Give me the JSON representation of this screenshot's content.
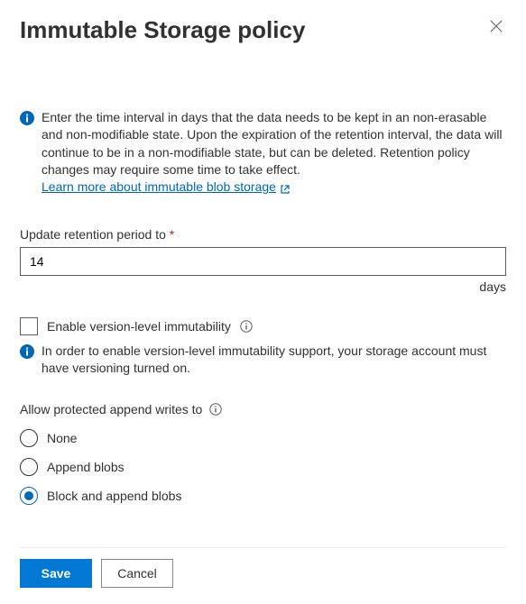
{
  "header": {
    "title": "Immutable Storage policy"
  },
  "info": {
    "text": "Enter the time interval in days that the data needs to be kept in an non-erasable and non-modifiable state. Upon the expiration of the retention interval, the data will continue to be in a non-modifiable state, but can be deleted. Retention policy changes may require some time to take effect.",
    "link_text": "Learn more about immutable blob storage"
  },
  "retention": {
    "label": "Update retention period to",
    "value": "14",
    "unit": "days"
  },
  "version_immutability": {
    "checkbox_label": "Enable version-level immutability",
    "info_text": "In order to enable version-level immutability support, your storage account must have versioning turned on."
  },
  "append_writes": {
    "label": "Allow protected append writes to",
    "options": {
      "none": "None",
      "append": "Append blobs",
      "block_append": "Block and append blobs"
    },
    "selected": "block_append"
  },
  "footer": {
    "save": "Save",
    "cancel": "Cancel"
  }
}
